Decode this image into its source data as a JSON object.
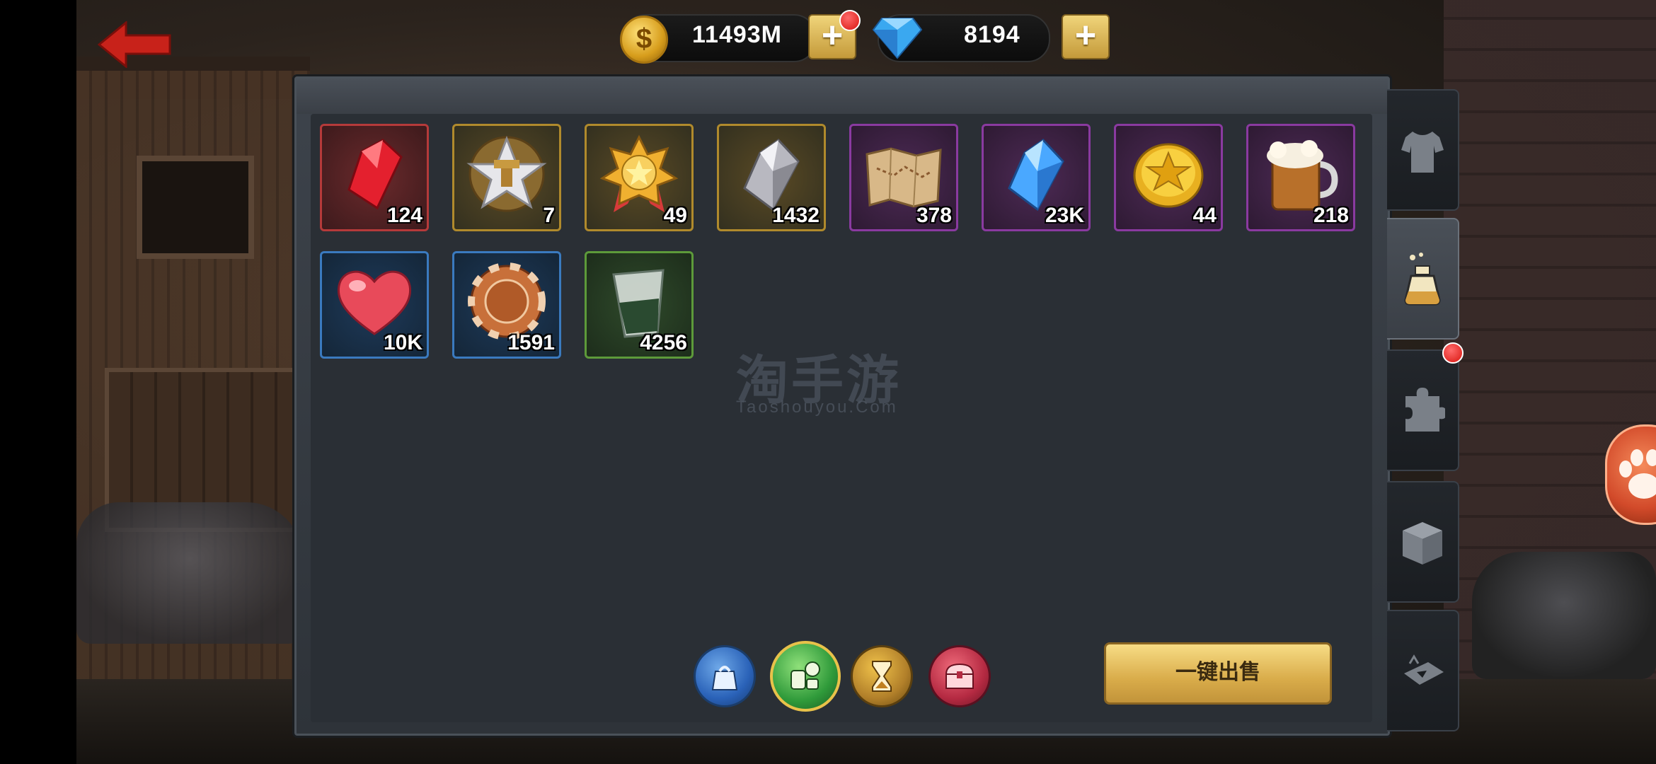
{
  "currency": {
    "gold": {
      "value": "11493M",
      "symbol": "$",
      "icon": "gold-coin-icon"
    },
    "gems": {
      "value": "8194",
      "icon": "blue-diamond-icon"
    },
    "plus_label": "+"
  },
  "inventory": {
    "items": [
      {
        "name": "red-crystal",
        "qty": "124",
        "rarity": "red"
      },
      {
        "name": "silver-star-hammer-medal",
        "qty": "7",
        "rarity": "gold"
      },
      {
        "name": "gold-star-medal",
        "qty": "49",
        "rarity": "gold"
      },
      {
        "name": "silver-crystal",
        "qty": "1432",
        "rarity": "gold"
      },
      {
        "name": "treasure-map",
        "qty": "378",
        "rarity": "purple"
      },
      {
        "name": "blue-crystal",
        "qty": "23K",
        "rarity": "purple"
      },
      {
        "name": "gold-star-coin",
        "qty": "44",
        "rarity": "purple"
      },
      {
        "name": "beer-mug",
        "qty": "218",
        "rarity": "purple"
      },
      {
        "name": "red-heart",
        "qty": "10K",
        "rarity": "blue"
      },
      {
        "name": "casino-chip",
        "qty": "1591",
        "rarity": "blue"
      },
      {
        "name": "shot-glass",
        "qty": "4256",
        "rarity": "green"
      }
    ]
  },
  "watermark": {
    "cn": "淘手游",
    "en": "Taoshouyou.Com"
  },
  "actions": {
    "sell_all": "一键出售"
  },
  "colors": {
    "red_frame": "#b53a3a",
    "gold_frame": "#b08a2c",
    "purple_frame": "#8a3aa0",
    "blue_frame": "#3a7abf",
    "green_frame": "#5d9a3a",
    "sell_button": "#d9ac4a"
  }
}
